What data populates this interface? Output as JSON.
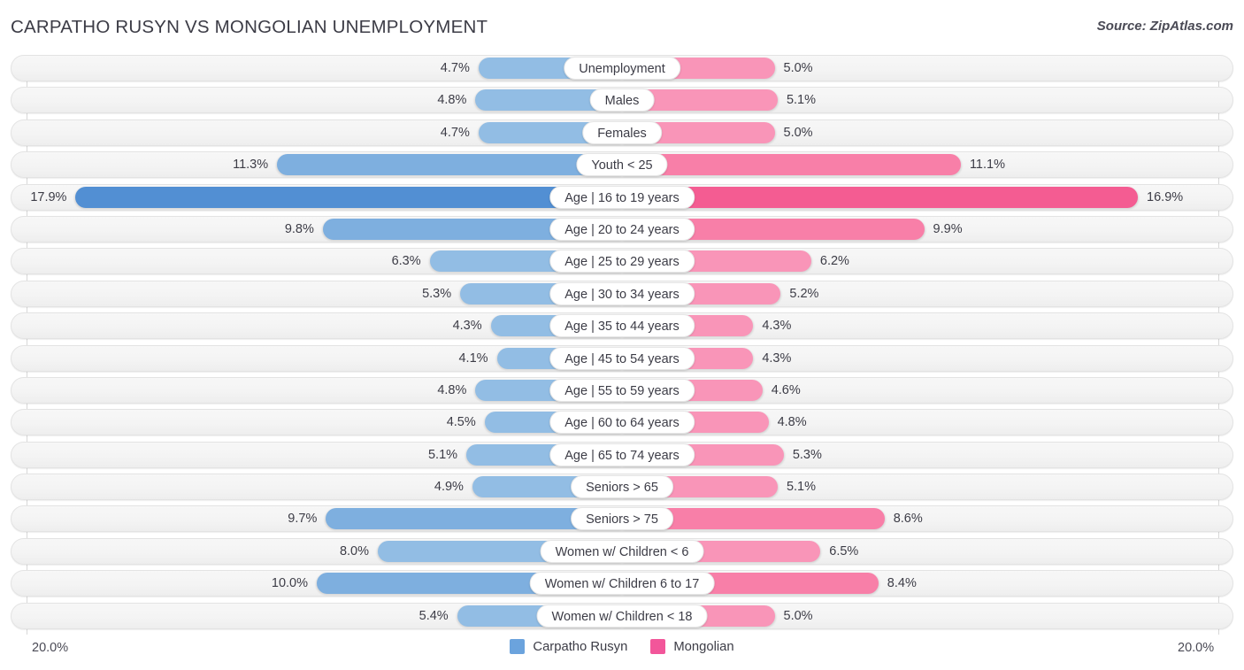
{
  "header": {
    "title": "CARPATHO RUSYN VS MONGOLIAN UNEMPLOYMENT",
    "source": "Source: ZipAtlas.com"
  },
  "axis": {
    "left_end": "20.0%",
    "right_end": "20.0%",
    "max": 20.0
  },
  "legend": {
    "items": [
      {
        "label": "Carpatho Rusyn",
        "color": "#6ba3dd"
      },
      {
        "label": "Mongolian",
        "color": "#f2569a"
      }
    ]
  },
  "chart_data": {
    "type": "bar",
    "orientation": "diverging-horizontal",
    "title": "CARPATHO RUSYN VS MONGOLIAN UNEMPLOYMENT",
    "xlabel": "",
    "ylabel": "",
    "xlim": [
      20.0,
      20.0
    ],
    "grid": true,
    "legend_position": "bottom-center",
    "categories": [
      "Unemployment",
      "Males",
      "Females",
      "Youth < 25",
      "Age | 16 to 19 years",
      "Age | 20 to 24 years",
      "Age | 25 to 29 years",
      "Age | 30 to 34 years",
      "Age | 35 to 44 years",
      "Age | 45 to 54 years",
      "Age | 55 to 59 years",
      "Age | 60 to 64 years",
      "Age | 65 to 74 years",
      "Seniors > 65",
      "Seniors > 75",
      "Women w/ Children < 6",
      "Women w/ Children 6 to 17",
      "Women w/ Children < 18"
    ],
    "series": [
      {
        "name": "Carpatho Rusyn",
        "color": "#6ba3dd",
        "values": [
          4.7,
          4.8,
          4.7,
          11.3,
          17.9,
          9.8,
          6.3,
          5.3,
          4.3,
          4.1,
          4.8,
          4.5,
          5.1,
          4.9,
          9.7,
          8.0,
          10.0,
          5.4
        ],
        "labels": [
          "4.7%",
          "4.8%",
          "4.7%",
          "11.3%",
          "17.9%",
          "9.8%",
          "6.3%",
          "5.3%",
          "4.3%",
          "4.1%",
          "4.8%",
          "4.5%",
          "5.1%",
          "4.9%",
          "9.7%",
          "8.0%",
          "10.0%",
          "5.4%"
        ]
      },
      {
        "name": "Mongolian",
        "color": "#f2569a",
        "values": [
          5.0,
          5.1,
          5.0,
          11.1,
          16.9,
          9.9,
          6.2,
          5.2,
          4.3,
          4.3,
          4.6,
          4.8,
          5.3,
          5.1,
          8.6,
          6.5,
          8.4,
          5.0
        ],
        "labels": [
          "5.0%",
          "5.1%",
          "5.0%",
          "11.1%",
          "16.9%",
          "9.9%",
          "6.2%",
          "5.2%",
          "4.3%",
          "4.3%",
          "4.6%",
          "4.8%",
          "5.3%",
          "5.1%",
          "8.6%",
          "6.5%",
          "8.4%",
          "5.0%"
        ]
      }
    ]
  }
}
